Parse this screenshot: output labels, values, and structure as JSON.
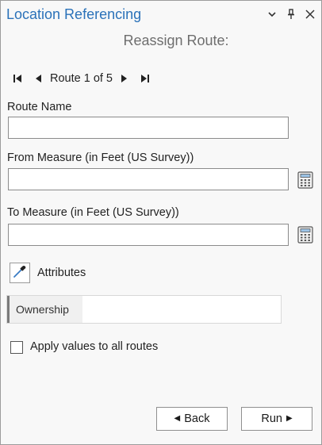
{
  "pane": {
    "title": "Location Referencing",
    "subtitle": "Reassign Route:"
  },
  "title_controls": {
    "menu_icon": "chevron-down-icon",
    "pin_icon": "pin-icon",
    "close_icon": "close-icon"
  },
  "navigator": {
    "text": "Route 1 of 5"
  },
  "fields": {
    "route_name_label": "Route Name",
    "route_name_value": "",
    "from_measure_label": "From Measure (in Feet (US Survey))",
    "from_measure_value": "",
    "to_measure_label": "To Measure (in Feet (US Survey))",
    "to_measure_value": ""
  },
  "attributes": {
    "label": "Attributes",
    "rows": [
      {
        "name": "Ownership",
        "value": ""
      }
    ]
  },
  "apply_all": {
    "label": "Apply values to all routes",
    "checked": false
  },
  "buttons": {
    "back": "Back",
    "run": "Run"
  },
  "colors": {
    "title": "#2b72b9",
    "subtitle": "#6e6e6e",
    "panel_bg": "#f8f8f8"
  }
}
